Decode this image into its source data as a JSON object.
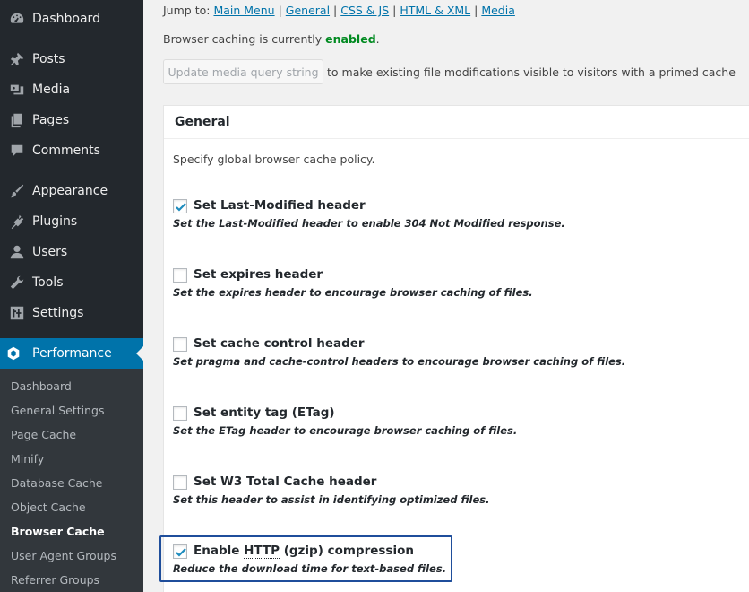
{
  "sidebar": {
    "menu": [
      {
        "label": "Dashboard",
        "icon": "dashboard-icon"
      },
      {
        "label": "Posts",
        "icon": "pin-icon"
      },
      {
        "label": "Media",
        "icon": "media-icon"
      },
      {
        "label": "Pages",
        "icon": "pages-icon"
      },
      {
        "label": "Comments",
        "icon": "comments-icon"
      },
      {
        "label": "Appearance",
        "icon": "brush-icon"
      },
      {
        "label": "Plugins",
        "icon": "plugin-icon"
      },
      {
        "label": "Users",
        "icon": "users-icon"
      },
      {
        "label": "Tools",
        "icon": "wrench-icon"
      },
      {
        "label": "Settings",
        "icon": "settings-icon"
      }
    ],
    "active": {
      "label": "Performance",
      "icon": "performance-icon"
    },
    "submenu": [
      "Dashboard",
      "General Settings",
      "Page Cache",
      "Minify",
      "Database Cache",
      "Object Cache",
      "Browser Cache",
      "User Agent Groups",
      "Referrer Groups"
    ],
    "current_submenu": "Browser Cache"
  },
  "jump": {
    "prefix": "Jump to:",
    "links": [
      "Main Menu",
      "General",
      "CSS & JS",
      "HTML & XML",
      "Media"
    ],
    "separator": "|"
  },
  "status": {
    "prefix": "Browser caching is currently",
    "state": "enabled",
    "suffix": "."
  },
  "update": {
    "button_label": "Update media query string",
    "description": "to make existing file modifications visible to visitors with a primed cache"
  },
  "general": {
    "title": "General",
    "description": "Specify global browser cache policy.",
    "options": [
      {
        "label": "Set Last-Modified header",
        "description": "Set the Last-Modified header to enable 304 Not Modified response.",
        "checked": true
      },
      {
        "label": "Set expires header",
        "description": "Set the expires header to encourage browser caching of files.",
        "checked": false
      },
      {
        "label": "Set cache control header",
        "description": "Set pragma and cache-control headers to encourage browser caching of files.",
        "checked": false
      },
      {
        "label": "Set entity tag (ETag)",
        "description": "Set the ETag header to encourage browser caching of files.",
        "checked": false
      },
      {
        "label": "Set W3 Total Cache header",
        "description": "Set this header to assist in identifying optimized files.",
        "checked": false
      },
      {
        "label_pre": "Enable ",
        "label_abbr": "HTTP",
        "label_post": " (gzip) compression",
        "description": "Reduce the download time for text-based files.",
        "checked": true
      }
    ]
  },
  "colors": {
    "sidebar_bg": "#23282d",
    "submenu_bg": "#32373c",
    "accent": "#0073aa",
    "enabled": "#008a20",
    "highlight_border": "#1f4e9b"
  }
}
